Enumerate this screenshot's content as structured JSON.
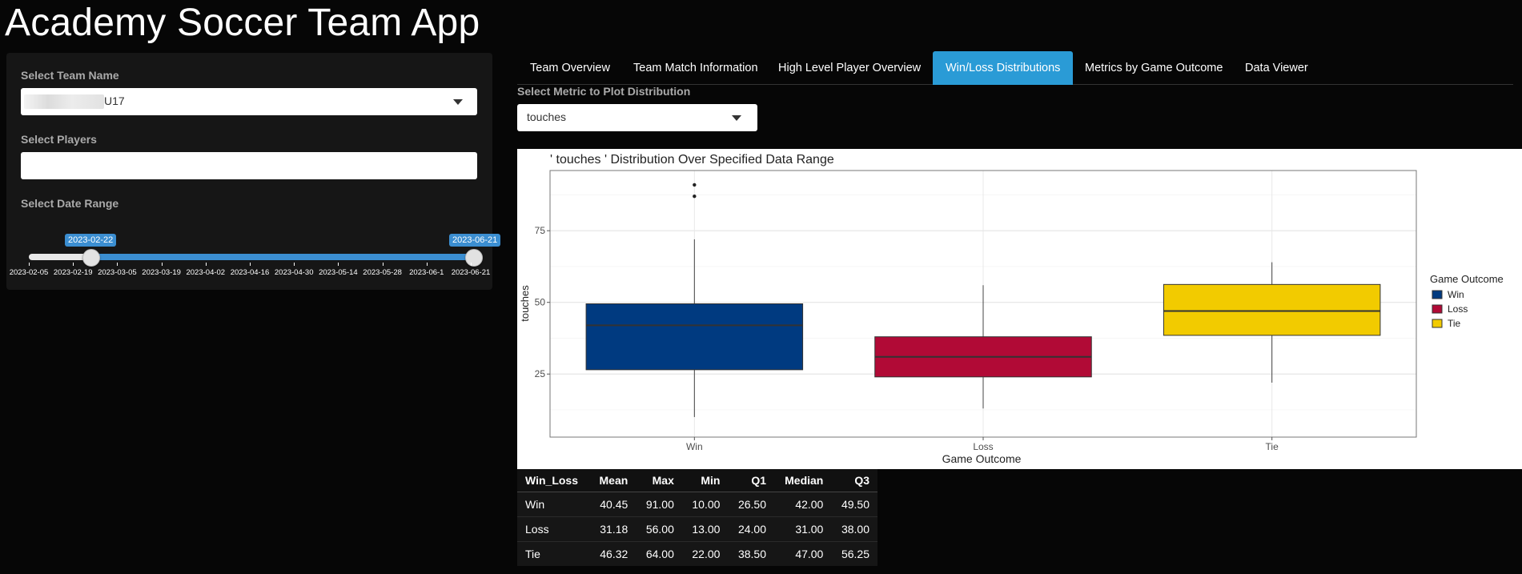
{
  "app": {
    "title": "Academy Soccer Team App"
  },
  "sidebar": {
    "team": {
      "label": "Select Team Name",
      "value": "U17"
    },
    "players": {
      "label": "Select Players",
      "value": ""
    },
    "date": {
      "label": "Select Date Range",
      "from": "2023-02-22",
      "to": "2023-06-21",
      "ticks": [
        "2023-02-05",
        "2023-02-19",
        "2023-03-05",
        "2023-03-19",
        "2023-04-02",
        "2023-04-16",
        "2023-04-30",
        "2023-05-14",
        "2023-05-28",
        "2023-06-1",
        "2023-06-21"
      ]
    }
  },
  "tabs": [
    {
      "label": "Team Overview"
    },
    {
      "label": "Team Match Information"
    },
    {
      "label": "High Level Player Overview"
    },
    {
      "label": "Win/Loss Distributions",
      "active": true
    },
    {
      "label": "Metrics by Game Outcome"
    },
    {
      "label": "Data Viewer"
    }
  ],
  "metric": {
    "label": "Select Metric to Plot Distribution",
    "value": "touches"
  },
  "chart_data": {
    "type": "box",
    "title": "' touches ' Distribution Over Specified Data Range",
    "xlabel": "Game Outcome",
    "ylabel": "touches",
    "categories": [
      "Win",
      "Loss",
      "Tie"
    ],
    "ylim": [
      3,
      96
    ],
    "yticks": [
      25,
      50,
      75
    ],
    "grid": true,
    "legend": {
      "title": "Game Outcome",
      "position": "right"
    },
    "colors": {
      "Win": "#003a80",
      "Loss": "#b10a36",
      "Tie": "#f2cb00"
    },
    "boxes": [
      {
        "name": "Win",
        "min": 10,
        "q1": 26.5,
        "median": 42,
        "q3": 49.5,
        "upper_whisker": 72,
        "outliers": [
          87,
          91
        ]
      },
      {
        "name": "Loss",
        "min": 13,
        "q1": 24,
        "median": 31,
        "q3": 38,
        "upper_whisker": 56,
        "outliers": []
      },
      {
        "name": "Tie",
        "min": 22,
        "q1": 38.5,
        "median": 47,
        "q3": 56.25,
        "upper_whisker": 64,
        "outliers": []
      }
    ]
  },
  "table": {
    "headers": [
      "Win_Loss",
      "Mean",
      "Max",
      "Min",
      "Q1",
      "Median",
      "Q3"
    ],
    "rows": [
      [
        "Win",
        "40.45",
        "91.00",
        "10.00",
        "26.50",
        "42.00",
        "49.50"
      ],
      [
        "Loss",
        "31.18",
        "56.00",
        "13.00",
        "24.00",
        "31.00",
        "38.00"
      ],
      [
        "Tie",
        "46.32",
        "64.00",
        "22.00",
        "38.50",
        "47.00",
        "56.25"
      ]
    ]
  }
}
